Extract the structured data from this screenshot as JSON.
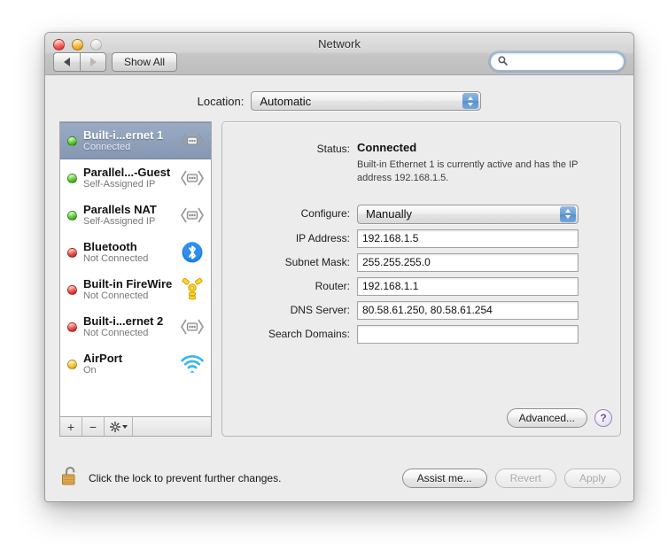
{
  "window": {
    "title": "Network",
    "traffic_lights": [
      "close-button",
      "minimize-button",
      "zoom-button"
    ]
  },
  "toolbar": {
    "back_label": "back-arrow",
    "forward_label": "forward-arrow",
    "show_all_label": "Show All",
    "search_placeholder": "",
    "search_value": ""
  },
  "location": {
    "label": "Location:",
    "value": "Automatic"
  },
  "services": [
    {
      "name": "Built-i...ernet 1",
      "status": "Connected",
      "dot": "green",
      "icon": "ethernet-icon",
      "selected": true
    },
    {
      "name": "Parallel...-Guest",
      "status": "Self-Assigned IP",
      "dot": "green",
      "icon": "ethernet-icon",
      "selected": false
    },
    {
      "name": "Parallels NAT",
      "status": "Self-Assigned IP",
      "dot": "green",
      "icon": "ethernet-icon",
      "selected": false
    },
    {
      "name": "Bluetooth",
      "status": "Not Connected",
      "dot": "red",
      "icon": "bluetooth-icon",
      "selected": false
    },
    {
      "name": "Built-in FireWire",
      "status": "Not Connected",
      "dot": "red",
      "icon": "firewire-icon",
      "selected": false
    },
    {
      "name": "Built-i...ernet 2",
      "status": "Not Connected",
      "dot": "red",
      "icon": "ethernet-icon",
      "selected": false
    },
    {
      "name": "AirPort",
      "status": "On",
      "dot": "yellow",
      "icon": "airport-icon",
      "selected": false
    }
  ],
  "service_toolbar": {
    "add_label": "+",
    "remove_label": "−",
    "action_label": "gear-icon"
  },
  "details": {
    "status_label": "Status:",
    "status_value": "Connected",
    "status_description": "Built-in Ethernet 1 is currently active and has the IP address 192.168.1.5.",
    "configure_label": "Configure:",
    "configure_value": "Manually",
    "fields": [
      {
        "label": "IP Address:",
        "value": "192.168.1.5"
      },
      {
        "label": "Subnet Mask:",
        "value": "255.255.255.0"
      },
      {
        "label": "Router:",
        "value": "192.168.1.1"
      },
      {
        "label": "DNS Server:",
        "value": "80.58.61.250, 80.58.61.254"
      },
      {
        "label": "Search Domains:",
        "value": ""
      }
    ],
    "advanced_label": "Advanced...",
    "help_label": "?"
  },
  "footer": {
    "lock_icon": "unlocked-padlock-icon",
    "lock_text": "Click the lock to prevent further changes.",
    "assist_label": "Assist me...",
    "revert_label": "Revert",
    "apply_label": "Apply",
    "revert_disabled": true,
    "apply_disabled": true
  },
  "colors": {
    "selection": "#8c9eb8",
    "window_bg": "#ececec",
    "accent_blue": "#6ea0d6",
    "help_purple": "#6d4fa3",
    "status_green": "#4fc223",
    "status_red": "#e04135",
    "status_yellow": "#f4bf2a"
  }
}
